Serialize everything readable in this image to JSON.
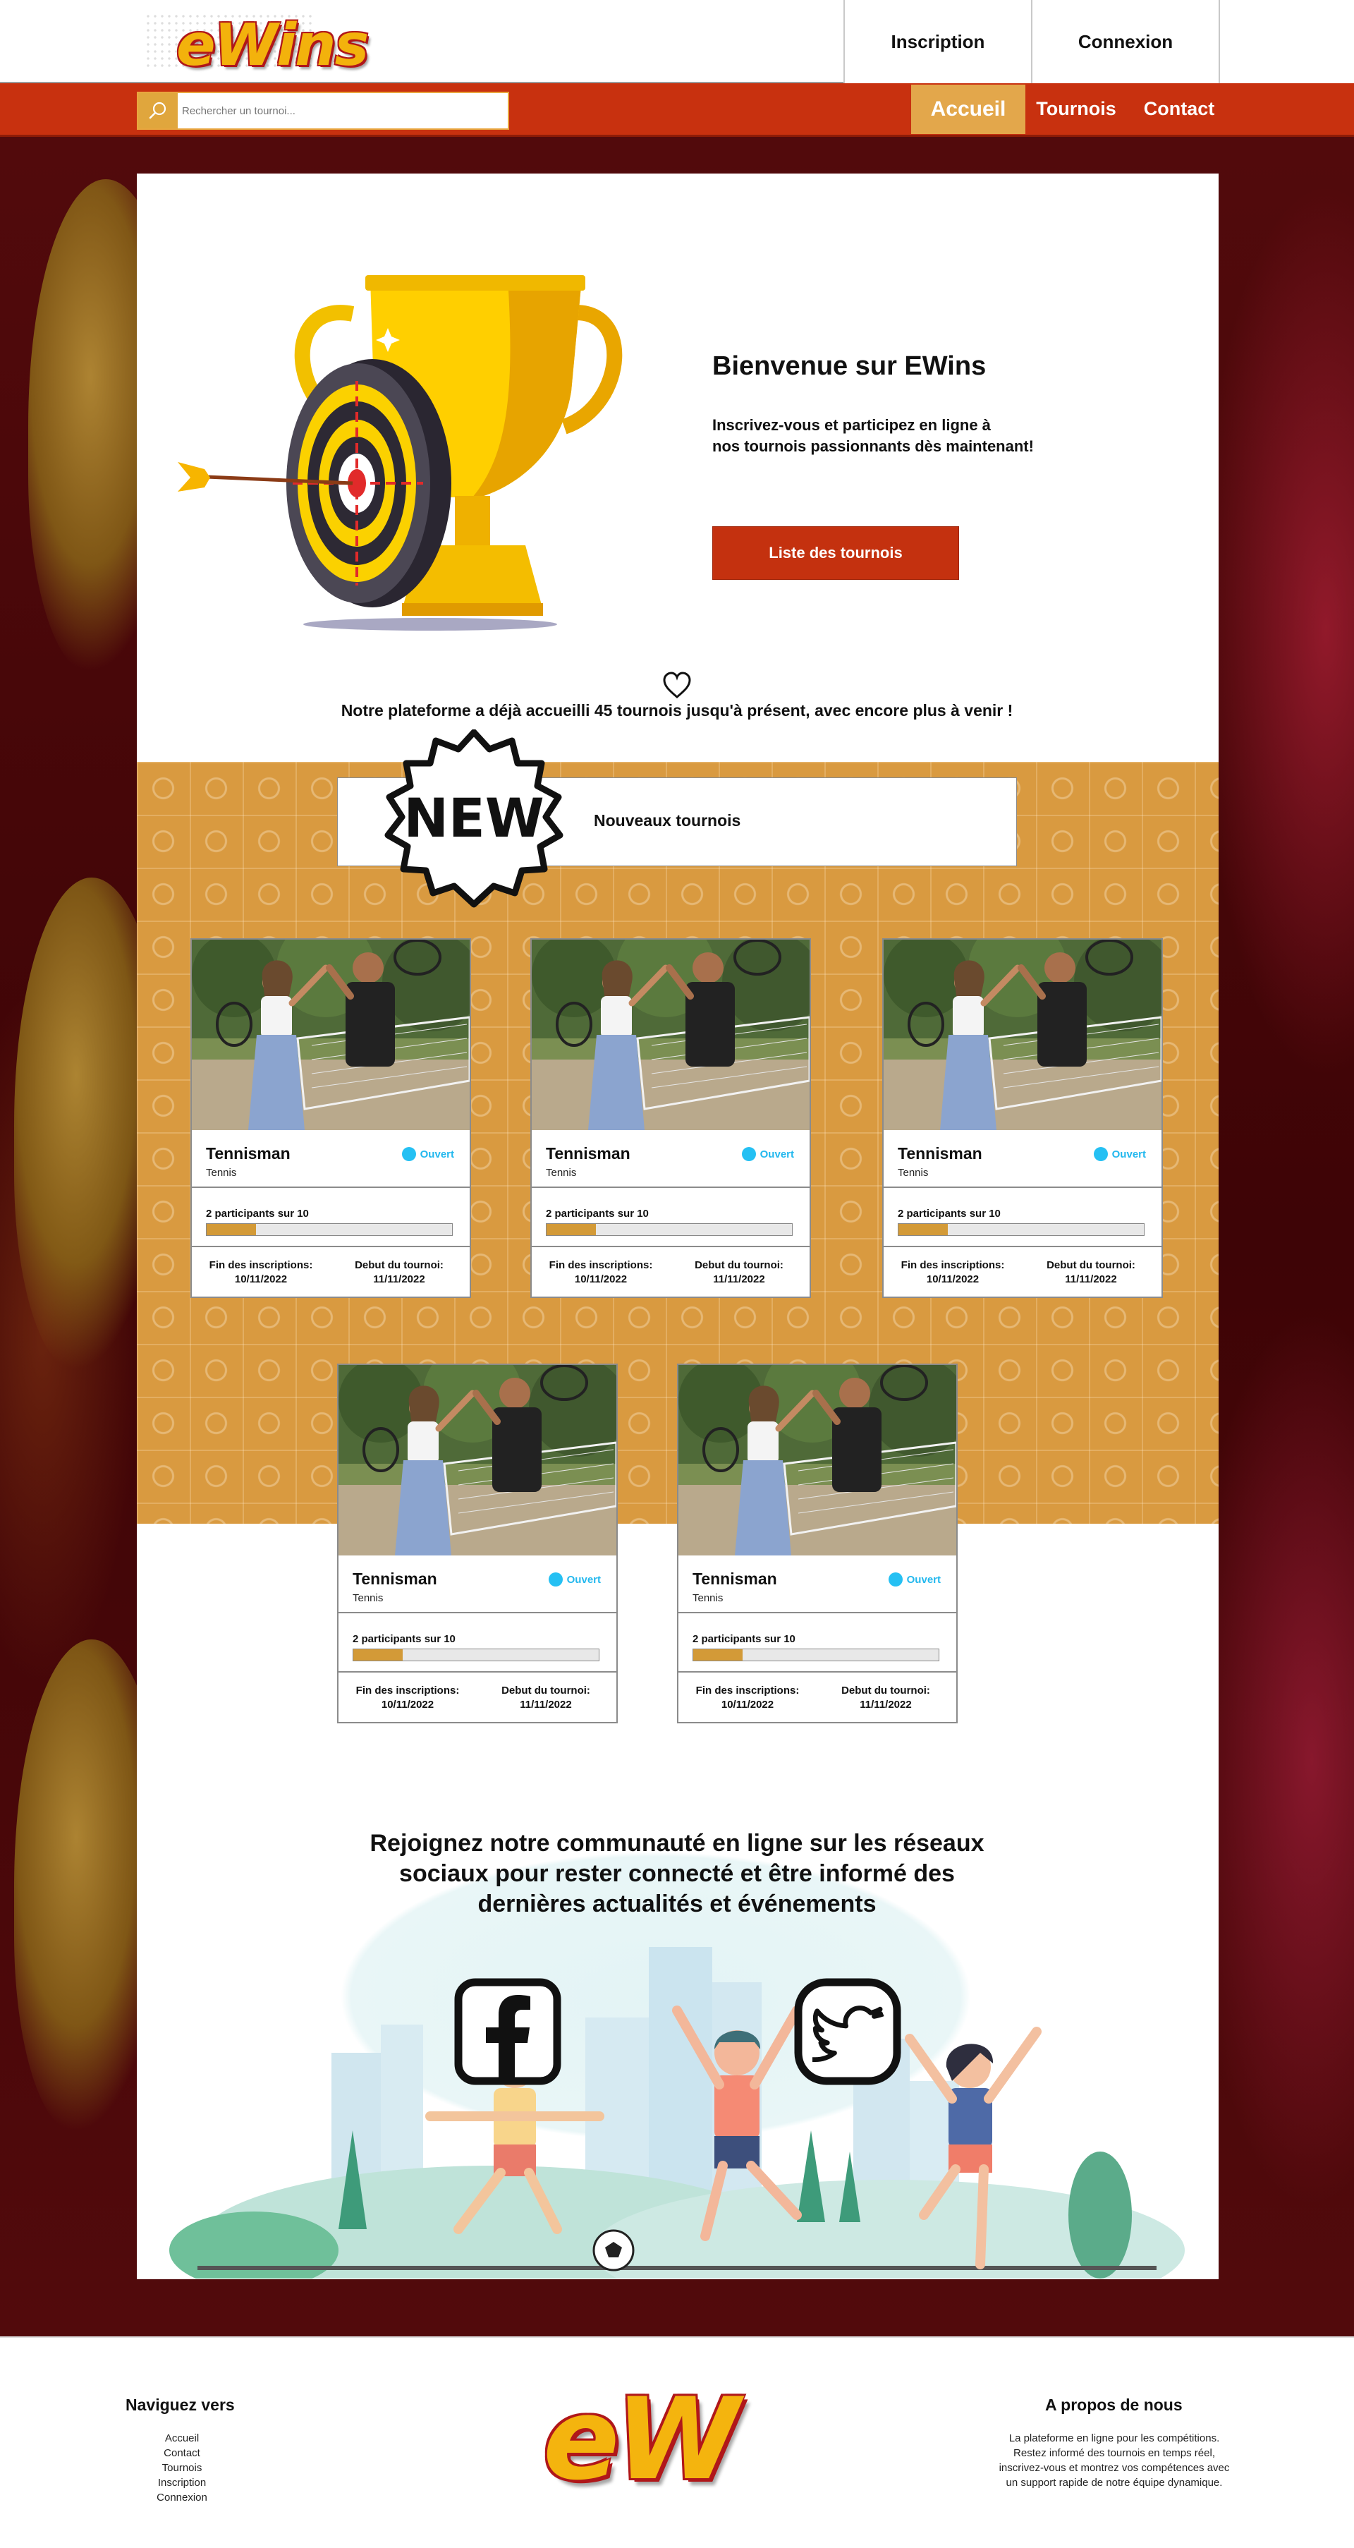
{
  "header": {
    "logo": "eWins",
    "inscription_label": "Inscription",
    "connexion_label": "Connexion"
  },
  "navbar": {
    "search_placeholder": "Rechercher un tournoi...",
    "items": [
      {
        "label": "Accueil",
        "active": true
      },
      {
        "label": "Tournois",
        "active": false
      },
      {
        "label": "Contact",
        "active": false
      }
    ]
  },
  "hero": {
    "title": "Bienvenue sur EWins",
    "line1": "Inscrivez-vous et participez en ligne à",
    "line2": "nos tournois passionnants dès maintenant!",
    "button_label": "Liste des tournois",
    "stats": "Notre plateforme a déjà accueilli 45 tournois jusqu'à présent, avec encore plus à venir !"
  },
  "new_section": {
    "badge": "NEW",
    "title": "Nouveaux tournois"
  },
  "tournaments": [
    {
      "title": "Tennisman",
      "sport": "Tennis",
      "status": "Ouvert",
      "participants": "2 participants sur 10",
      "fill": 0.2,
      "reg_label": "Fin des inscriptions:",
      "reg_date": "10/11/2022",
      "start_label": "Debut du tournoi:",
      "start_date": "11/11/2022"
    },
    {
      "title": "Tennisman",
      "sport": "Tennis",
      "status": "Ouvert",
      "participants": "2 participants sur 10",
      "fill": 0.2,
      "reg_label": "Fin des inscriptions:",
      "reg_date": "10/11/2022",
      "start_label": "Debut du tournoi:",
      "start_date": "11/11/2022"
    },
    {
      "title": "Tennisman",
      "sport": "Tennis",
      "status": "Ouvert",
      "participants": "2 participants sur 10",
      "fill": 0.2,
      "reg_label": "Fin des inscriptions:",
      "reg_date": "10/11/2022",
      "start_label": "Debut du tournoi:",
      "start_date": "11/11/2022"
    },
    {
      "title": "Tennisman",
      "sport": "Tennis",
      "status": "Ouvert",
      "participants": "2 participants sur 10",
      "fill": 0.2,
      "reg_label": "Fin des inscriptions:",
      "reg_date": "10/11/2022",
      "start_label": "Debut du tournoi:",
      "start_date": "11/11/2022"
    },
    {
      "title": "Tennisman",
      "sport": "Tennis",
      "status": "Ouvert",
      "participants": "2 participants sur 10",
      "fill": 0.2,
      "reg_label": "Fin des inscriptions:",
      "reg_date": "10/11/2022",
      "start_label": "Debut du tournoi:",
      "start_date": "11/11/2022"
    }
  ],
  "community": {
    "line1": "Rejoignez notre communauté en ligne sur les réseaux",
    "line2": "sociaux pour rester connecté et être informé des",
    "line3": "dernières actualités et événements",
    "socials": [
      "facebook-icon",
      "twitter-icon"
    ]
  },
  "footer": {
    "nav_title": "Naviguez vers",
    "nav_links": [
      "Accueil",
      "Contact",
      "Tournois",
      "Inscription",
      "Connexion"
    ],
    "about_title": "A propos de nous",
    "about_lines": [
      "La plateforme en ligne pour les compétitions.",
      "Restez informé des tournois en temps réel,",
      "inscrivez-vous et montrez vos compétences avec",
      "un support rapide de notre équipe dynamique."
    ],
    "logo": "eW"
  },
  "colors": {
    "brand_red": "#c8310f",
    "brand_gold": "#d99a40",
    "status_blue": "#25c0f3"
  }
}
